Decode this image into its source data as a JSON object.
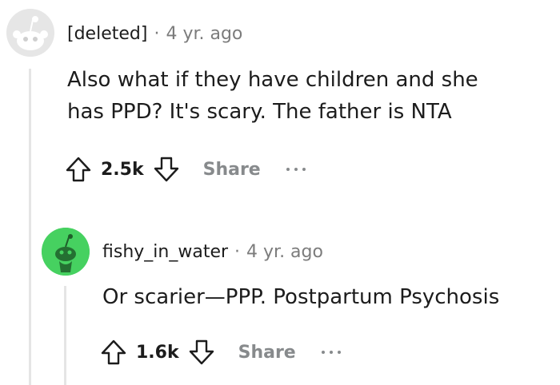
{
  "comments": [
    {
      "author": "[deleted]",
      "separator": "·",
      "time": "4 yr. ago",
      "body_line1": "Also what if they have children and she",
      "body_line2": "has PPD? It's scary. The father is NTA",
      "score": "2.5k",
      "share_label": "Share",
      "avatar_color": "#dadada",
      "avatar_icon": "deleted-user-icon"
    },
    {
      "author": "fishy_in_water",
      "separator": "·",
      "time": "4 yr. ago",
      "body": "Or scarier—PPP. Postpartum Psychosis",
      "score": "1.6k",
      "share_label": "Share",
      "avatar_color": "#46d160",
      "avatar_icon": "snoo-avatar-icon"
    }
  ],
  "colors": {
    "text": "#1c1c1c",
    "meta": "#7c7c7c",
    "action": "#878a8c",
    "thread_line": "#e5e5e5"
  }
}
